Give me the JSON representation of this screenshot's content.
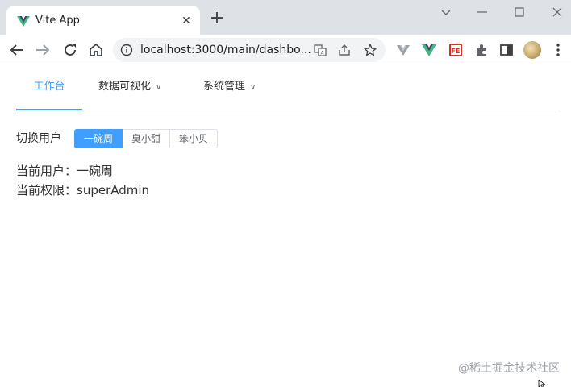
{
  "browser": {
    "tab_title": "Vite App",
    "url": "localhost:3000/main/dashbo..."
  },
  "nav": {
    "items": [
      {
        "label": "工作台",
        "active": true
      },
      {
        "label": "数据可视化",
        "active": false
      },
      {
        "label": "系统管理",
        "active": false
      }
    ]
  },
  "switch_user": {
    "label": "切换用户",
    "options": [
      "一碗周",
      "臭小甜",
      "笨小贝"
    ],
    "selected": "一碗周"
  },
  "info": {
    "current_user": "当前用户：一碗周",
    "current_permission": "当前权限：superAdmin"
  },
  "watermark": "@稀土掘金技术社区",
  "colors": {
    "primary": "#409eff",
    "vue_green": "#41b883",
    "vue_dark": "#35495e"
  }
}
